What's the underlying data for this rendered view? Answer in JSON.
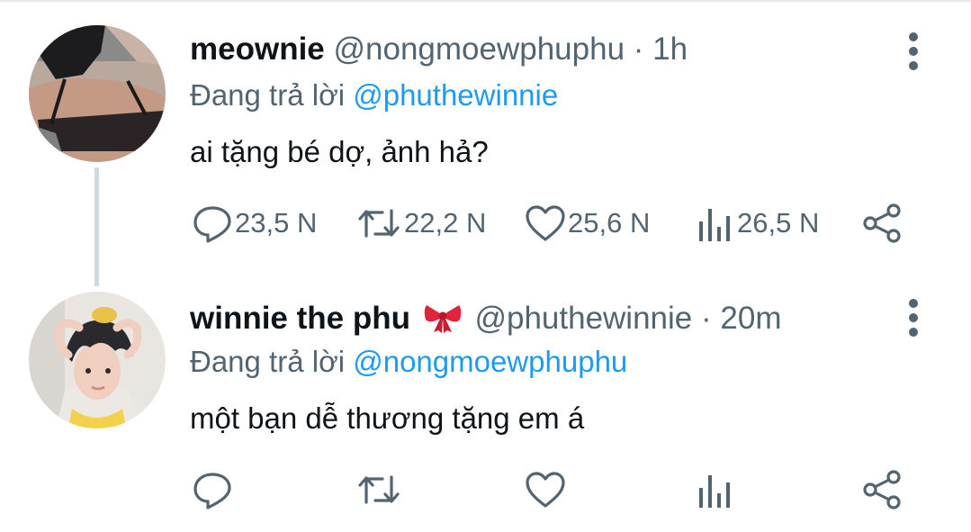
{
  "tweets": [
    {
      "name": "meownie",
      "handle": "@nongmoewphuphu",
      "separator": "·",
      "time": "1h",
      "reply_prefix": "Đang trả lời",
      "reply_to": "@phuthewinnie",
      "text": "ai tặng bé dợ, ảnh hả?",
      "stats": {
        "replies": "23,5 N",
        "retweets": "22,2 N",
        "likes": "25,6 N",
        "views": "26,5 N"
      }
    },
    {
      "name": "winnie the phu",
      "name_emoji": "ribbon-bow",
      "handle": "@phuthewinnie",
      "separator": "·",
      "time": "20m",
      "reply_prefix": "Đang trả lời",
      "reply_to": "@nongmoewphuphu",
      "text": "một bạn dễ thương tặng em á",
      "stats": {
        "replies": "",
        "retweets": "",
        "likes": "",
        "views": ""
      }
    }
  ],
  "icons": [
    "reply-icon",
    "retweet-icon",
    "like-icon",
    "views-icon",
    "share-icon",
    "more-icon"
  ],
  "colors": {
    "text": "#0f1419",
    "muted": "#536471",
    "mention": "#1d9bf0",
    "thread_line": "#cfd9de",
    "bow": "#e0243b"
  }
}
